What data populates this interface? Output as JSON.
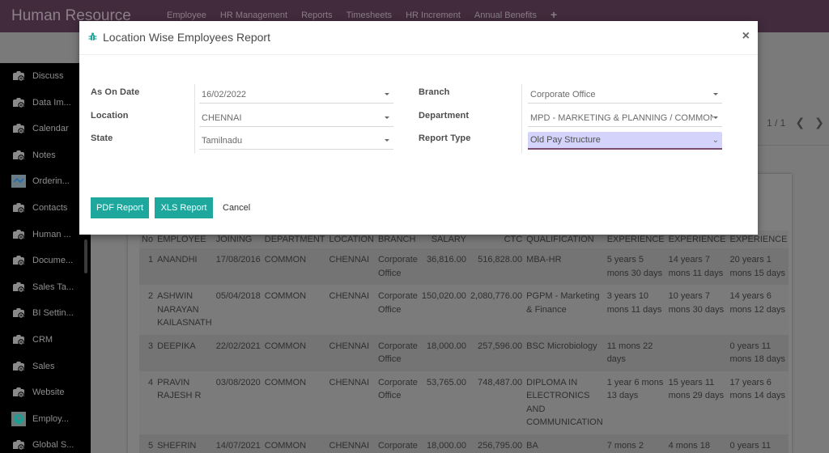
{
  "navbar": {
    "app_title": "Human Resource",
    "menu": [
      "Employee",
      "HR Management",
      "Reports",
      "Timesheets",
      "HR Increment",
      "Annual Benefits"
    ],
    "add_icon": "plus-icon"
  },
  "sidebar": {
    "items": [
      {
        "label": "Discuss",
        "icon": "app-icon"
      },
      {
        "label": "Data Im...",
        "icon": "app-icon"
      },
      {
        "label": "Calendar",
        "icon": "app-icon"
      },
      {
        "label": "Notes",
        "icon": "app-icon"
      },
      {
        "label": "Orderin...",
        "icon": "handshake-icon"
      },
      {
        "label": "Contacts",
        "icon": "app-icon"
      },
      {
        "label": "Human ...",
        "icon": "app-icon"
      },
      {
        "label": "Docume...",
        "icon": "app-icon"
      },
      {
        "label": "Sales Ta...",
        "icon": "app-icon"
      },
      {
        "label": "BI Settin...",
        "icon": "app-icon"
      },
      {
        "label": "CRM",
        "icon": "app-icon"
      },
      {
        "label": "Sales",
        "icon": "app-icon"
      },
      {
        "label": "Website",
        "icon": "app-icon"
      },
      {
        "label": "Employ...",
        "icon": "map-pin-icon"
      },
      {
        "label": "Global S...",
        "icon": "app-icon"
      }
    ]
  },
  "pager": {
    "text": "1 / 1",
    "prev": "‹",
    "next": "›"
  },
  "modal": {
    "title": "Location Wise Employees Report",
    "title_icon": "bug-icon",
    "close_label": "×",
    "fields_left": [
      {
        "label": "As On Date",
        "value": "16/02/2022"
      },
      {
        "label": "Location",
        "value": "CHENNAI"
      },
      {
        "label": "State",
        "value": "Tamilnadu"
      }
    ],
    "fields_right": [
      {
        "label": "Branch",
        "value": "Corporate Office"
      },
      {
        "label": "Department",
        "value": "MPD - MARKETING & PLANNING / COMMON"
      },
      {
        "label": "Report Type",
        "value": "Old Pay Structure"
      }
    ],
    "buttons": {
      "pdf": "PDF Report",
      "xls": "XLS Report",
      "cancel": "Cancel"
    }
  },
  "report": {
    "columns": [
      "No",
      "EMPLOYEE",
      "JOINING",
      "DEPARTMENT",
      "LOCATION",
      "BRANCH",
      "SALARY",
      "CTC",
      "QUALIFICATION",
      "EXPERIENCE",
      "EXPERIENCE",
      "EXPERIENCE"
    ],
    "rows": [
      [
        "1",
        "ANANDHI",
        "17/08/2016",
        "COMMON",
        "CHENNAI",
        "Corporate Office",
        "36,816.00",
        "516,828.00",
        "MBA-HR",
        "5 years 5 mons 30 days",
        "14 years 7 mons 11 days",
        "20 years 1 mons 15 days"
      ],
      [
        "2",
        "ASHWIN NARAYAN KAILASNATH",
        "05/04/2018",
        "COMMON",
        "CHENNAI",
        "Corporate Office",
        "150,020.00",
        "2,080,776.00",
        "PGPM - Marketing & Finance",
        "3 years 10 mons 11 days",
        "10 years 7 mons 30 days",
        "14 years 6 mons 12 days"
      ],
      [
        "3",
        "DEEPIKA",
        "22/02/2021",
        "COMMON",
        "CHENNAI",
        "Corporate Office",
        "18,000.00",
        "257,596.00",
        "BSC Microbiology",
        "11 mons 22 days",
        "",
        "0 years 11 mons 18 days"
      ],
      [
        "4",
        "PRAVIN RAJESH R",
        "03/08/2020",
        "COMMON",
        "CHENNAI",
        "Corporate Office",
        "53,765.00",
        "748,487.00",
        "DIPLOMA IN ELECTRONICS AND COMMUNICATION",
        "1 year 6 mons 13 days",
        "15 years 11 mons 29 days",
        "17 years 6 mons 14 days"
      ],
      [
        "5",
        "SHEFRIN",
        "14/07/2021",
        "COMMON",
        "CHENNAI",
        "Corporate",
        "18,000.00",
        "256,795.00",
        "BA",
        "7 mons 2",
        "4 mons 18",
        "0 years 11"
      ]
    ]
  }
}
